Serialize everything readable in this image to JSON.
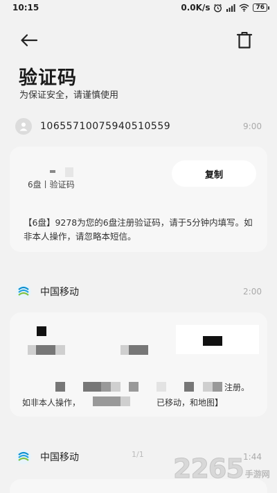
{
  "status_bar": {
    "time": "10:15",
    "network_speed": "0.0K/s",
    "battery": "76",
    "icons": [
      "alarm-icon",
      "signal-icon",
      "wifi-icon",
      "battery-icon"
    ]
  },
  "header": {
    "back_icon": "arrow-left-icon",
    "delete_icon": "trash-icon",
    "title": "验证码",
    "subtitle": "为保证安全，请谨慎使用"
  },
  "messages": [
    {
      "sender": "10655710075940510559",
      "time": "9:00",
      "code_meta": "6盘丨验证码",
      "copy_label": "复制",
      "body": "【6盘】9278为您的6盘注册验证码，请于5分钟内填写。如非本人操作，请忽略本短信。"
    },
    {
      "sender": "中国移动",
      "time": "2:00",
      "visible_fragment_1": "注册。",
      "visible_fragment_2": "如非本人操作，",
      "visible_fragment_3": "已移动，和地图】"
    },
    {
      "sender": "中国移动",
      "time": "1:44"
    }
  ],
  "page_indicator": "1/1",
  "watermark": {
    "number": "2265",
    "suffix": ".com",
    "label": "手游网"
  },
  "colors": {
    "background": "#f2f2f2",
    "card": "#f7f7f7",
    "copy_button": "#ffffff",
    "time_text": "#aaaaaa"
  }
}
